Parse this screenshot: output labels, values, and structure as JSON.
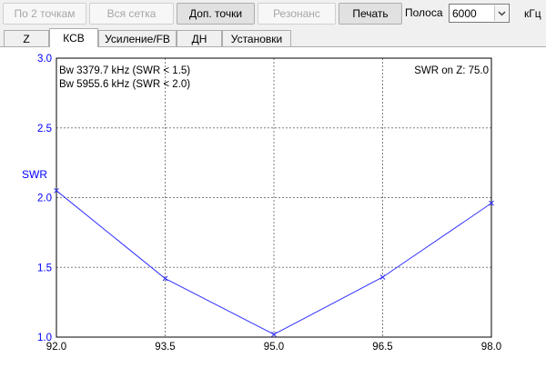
{
  "toolbar": {
    "btn_two_points": "По 2 точкам",
    "btn_all_grid": "Вся сетка",
    "btn_extra_points": "Доп. точки",
    "btn_resonance": "Резонанс",
    "btn_print": "Печать",
    "band_label": "Полоса",
    "band_value": "6000",
    "band_unit": "кГц"
  },
  "tabs": [
    "Z",
    "КСВ",
    "Усиление/FB",
    "ДН",
    "Установки"
  ],
  "active_tab": "КСВ",
  "colors": {
    "series": "#3030ff",
    "axis_label": "#0000ff",
    "grid": "#808080"
  },
  "chart_data": {
    "type": "line",
    "ylabel": "SWR",
    "xlabel": "",
    "xlim": [
      92.0,
      98.0
    ],
    "ylim": [
      1.0,
      3.0
    ],
    "x_ticks": [
      "92.0",
      "93.5",
      "95.0",
      "96.5",
      "98.0"
    ],
    "y_ticks": [
      "1.0",
      "1.5",
      "2.0",
      "2.5",
      "3.0"
    ],
    "grid": true,
    "series": [
      {
        "x": [
          92.0,
          93.5,
          95.0,
          96.5,
          98.0
        ],
        "y": [
          2.05,
          1.42,
          1.02,
          1.43,
          1.96
        ]
      }
    ],
    "annotations": {
      "bw1": "Bw 3379.7 kHz (SWR < 1.5)",
      "bw2": "Bw 5955.6 kHz (SWR < 2.0)",
      "swr_on_z": "SWR on Z: 75.0"
    }
  }
}
